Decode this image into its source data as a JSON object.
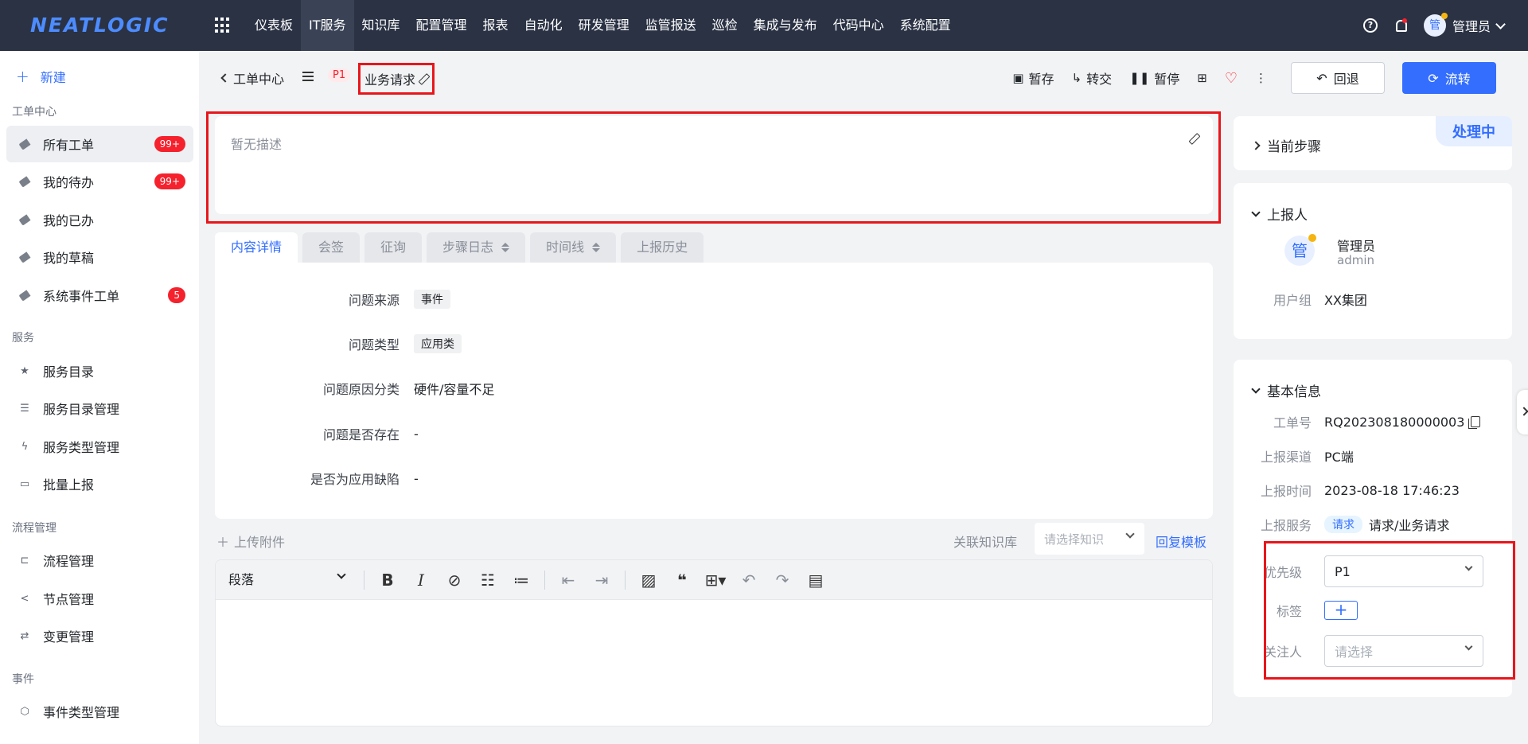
{
  "app": {
    "logo": "NEATLOGIC"
  },
  "topnav": [
    "仪表板",
    "IT服务",
    "知识库",
    "配置管理",
    "报表",
    "自动化",
    "研发管理",
    "监管报送",
    "巡检",
    "集成与发布",
    "代码中心",
    "系统配置"
  ],
  "topnav_active": "IT服务",
  "user": {
    "avatar_char": "管",
    "name": "管理员"
  },
  "sidebar": {
    "new_label": "新建",
    "groups": [
      {
        "title": "工单中心",
        "items": [
          {
            "label": "所有工单",
            "badge": "99+",
            "icon": "tag-icon",
            "active": true
          },
          {
            "label": "我的待办",
            "badge": "99+",
            "icon": "tag-icon"
          },
          {
            "label": "我的已办",
            "icon": "tag-icon"
          },
          {
            "label": "我的草稿",
            "icon": "tag-icon"
          },
          {
            "label": "系统事件工单",
            "badge": "5",
            "icon": "tag-icon"
          }
        ]
      },
      {
        "title": "服务",
        "items": [
          {
            "label": "服务目录",
            "icon": "star-icon"
          },
          {
            "label": "服务目录管理",
            "icon": "list-icon"
          },
          {
            "label": "服务类型管理",
            "icon": "bolt-circle-icon"
          },
          {
            "label": "批量上报",
            "icon": "batch-report-icon"
          }
        ]
      },
      {
        "title": "流程管理",
        "items": [
          {
            "label": "流程管理",
            "icon": "flow-icon"
          },
          {
            "label": "节点管理",
            "icon": "share-node-icon"
          },
          {
            "label": "变更管理",
            "icon": "swap-icon"
          }
        ]
      },
      {
        "title": "事件",
        "items": [
          {
            "label": "事件类型管理",
            "icon": "hexagon-icon"
          }
        ]
      }
    ]
  },
  "header": {
    "back_label": "工单中心",
    "priority": "P1",
    "title": "业务请求",
    "actions": {
      "save": "暂存",
      "transfer": "转交",
      "pause": "暂停"
    },
    "back_button": "回退",
    "flow_button": "流转"
  },
  "description": {
    "placeholder": "暂无描述"
  },
  "tabs": [
    "内容详情",
    "会签",
    "征询",
    "步骤日志",
    "时间线",
    "上报历史"
  ],
  "form": [
    {
      "label": "问题来源",
      "value": "事件",
      "chip": true
    },
    {
      "label": "问题类型",
      "value": "应用类",
      "chip": true
    },
    {
      "label": "问题原因分类",
      "value": "硬件/容量不足"
    },
    {
      "label": "问题是否存在",
      "value": "-"
    },
    {
      "label": "是否为应用缺陷",
      "value": "-"
    }
  ],
  "attachments": {
    "upload_label": "上传附件",
    "kb_label": "关联知识库",
    "kb_placeholder": "请选择知识",
    "restore_label": "回复模板"
  },
  "editor": {
    "paragraph": "段落"
  },
  "right": {
    "status": "处理中",
    "current_step": "当前步骤",
    "reporter_title": "上报人",
    "reporter": {
      "avatar_char": "管",
      "name": "管理员",
      "account": "admin",
      "group_label": "用户组",
      "group": "XX集团"
    },
    "basic_title": "基本信息",
    "basic": {
      "ticket_label": "工单号",
      "ticket": "RQ202308180000003",
      "channel_label": "上报渠道",
      "channel": "PC端",
      "time_label": "上报时间",
      "time": "2023-08-18 17:46:23",
      "service_label": "上报服务",
      "service_chip": "请求",
      "service": "请求/业务请求",
      "priority_label": "优先级",
      "priority": "P1",
      "tag_label": "标签",
      "watcher_label": "关注人",
      "watcher_placeholder": "请选择"
    }
  }
}
